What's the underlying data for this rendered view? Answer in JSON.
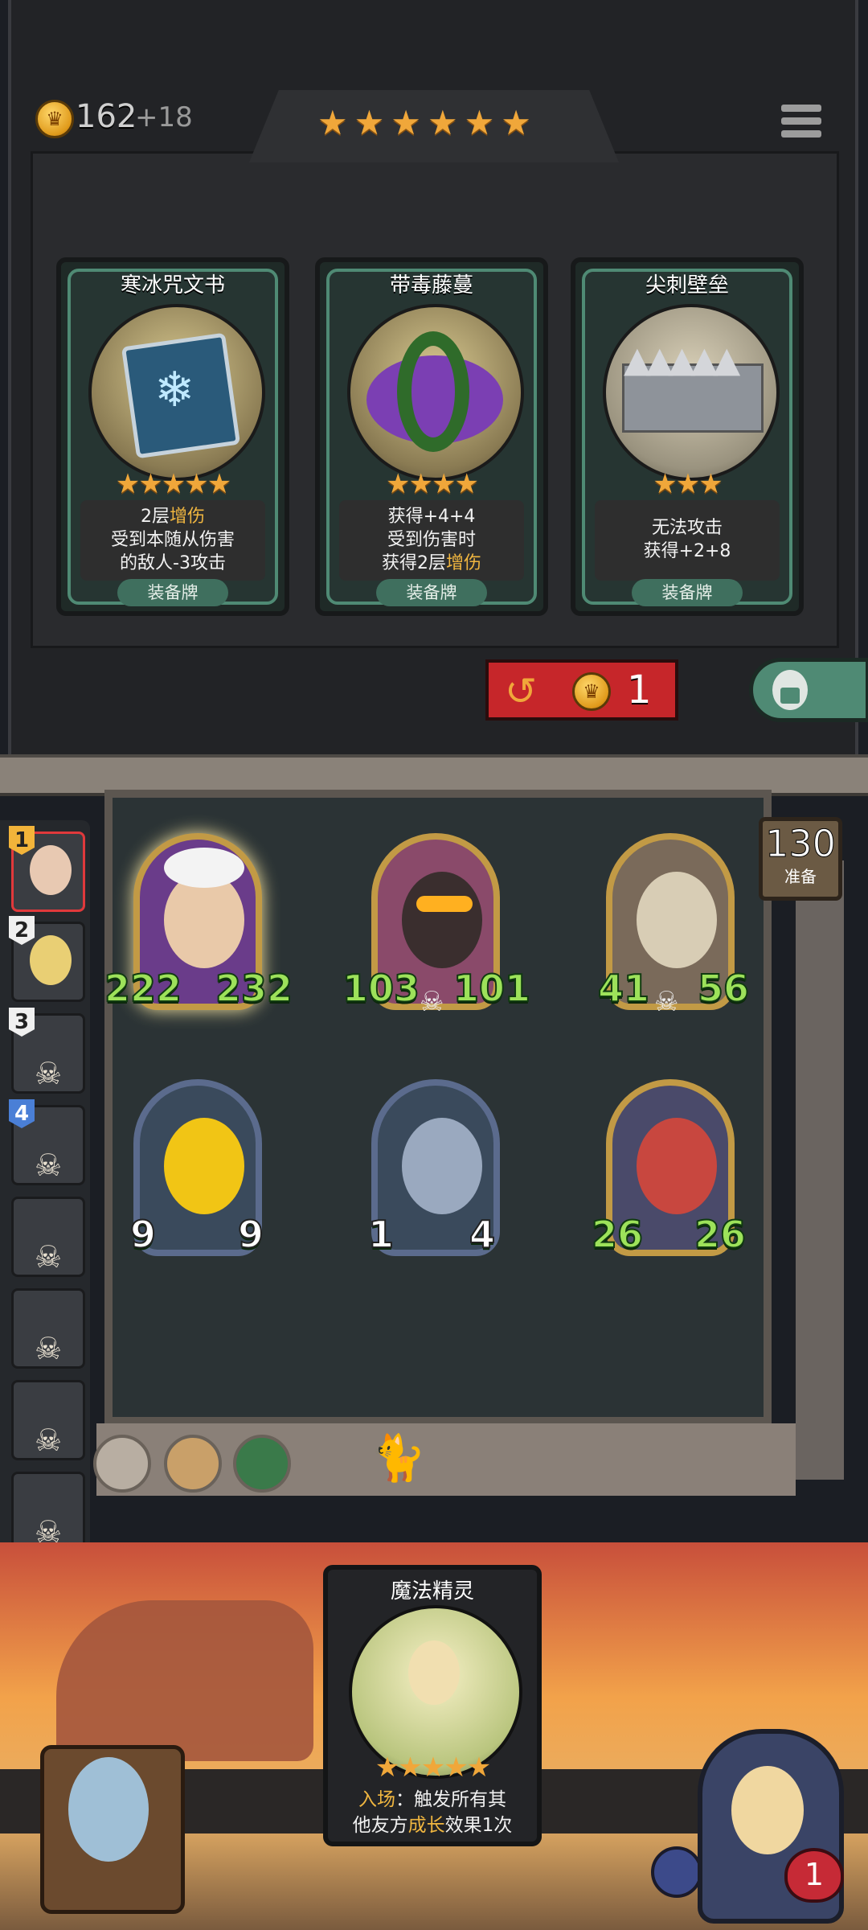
{
  "header": {
    "gold": "162",
    "gold_income": "+18",
    "tier_stars": "★★★★★★",
    "menu_icon": "hamburger-menu-icon"
  },
  "shop": {
    "cards": [
      {
        "name": "寒冰咒文书",
        "stars": "★★★★★",
        "desc": [
          "2层",
          "增伤",
          "受到本随从伤害",
          "的敌人-3攻击"
        ],
        "tag": "装备牌",
        "art": "ice-spellbook-icon"
      },
      {
        "name": "带毒藤蔓",
        "stars": "★★★★",
        "desc": [
          "获得+4+4",
          "受到伤害时",
          "获得2层",
          "增伤"
        ],
        "tag": "装备牌",
        "art": "poison-vine-icon"
      },
      {
        "name": "尖刺壁垒",
        "stars": "★★★",
        "desc": [
          "无法攻击",
          "获得+2+8"
        ],
        "tag": "装备牌",
        "art": "spike-wall-icon"
      }
    ],
    "refresh_cost": "1",
    "refresh_icon": "refresh-arrow-icon",
    "lock_icon": "lock-icon"
  },
  "timer": {
    "value": "130",
    "label": "准备"
  },
  "roster": [
    {
      "rank": "1",
      "active": true
    },
    {
      "rank": "2",
      "active": false
    },
    {
      "rank": "3",
      "active": false
    },
    {
      "rank": "4",
      "active": false
    },
    {
      "rank": "",
      "active": false
    },
    {
      "rank": "",
      "active": false
    },
    {
      "rank": "",
      "active": false
    },
    {
      "rank": "",
      "active": false
    }
  ],
  "board": {
    "units": [
      {
        "attack": "222",
        "health": "232"
      },
      {
        "attack": "103",
        "health": "101"
      },
      {
        "attack": "41",
        "health": "56"
      },
      {
        "attack": "9",
        "health": "9"
      },
      {
        "attack": "1",
        "health": "4"
      },
      {
        "attack": "26",
        "health": "26"
      }
    ]
  },
  "hand": {
    "name": "魔法精灵",
    "stars": "★★★★★",
    "desc_prefix": "入场",
    "desc_line1": "：触发所有其",
    "desc_line2a": "他友方",
    "desc_line2b": "成长",
    "desc_line2c": "效果1次"
  },
  "player": {
    "lives": "1"
  },
  "colors": {
    "gold": "#f0a73a",
    "highlight": "#f0b640",
    "stat_green": "#9de25a",
    "refresh_red": "#c6262a",
    "teal": "#4f8a74"
  }
}
